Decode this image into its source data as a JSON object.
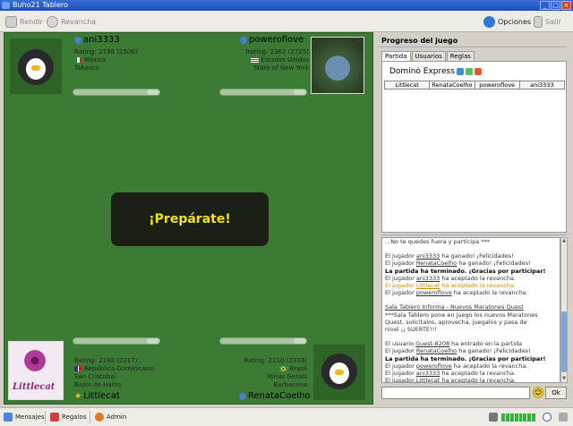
{
  "window": {
    "title": "Buho21 Tablero"
  },
  "toolbar": {
    "rendir": "Rendir",
    "revancha": "Revancha",
    "opciones": "Opciones",
    "salir": "Salir"
  },
  "players": {
    "top_left": {
      "name": "ani3333",
      "rating": "Rating: 2196 (2506)",
      "country": "México",
      "region": "Tabasco"
    },
    "top_right": {
      "name": "poweroflove",
      "rating": "Rating: 2362 (2725)",
      "country": "Estados Unidos",
      "region": "State of New York"
    },
    "bottom_left": {
      "name": "Littlecat",
      "rating": "Rating: 2193 (2217)",
      "country": "República Dominicana",
      "region": "San Cristobal",
      "city": "Bajos de Haina",
      "photo_text": "Littlecat"
    },
    "bottom_right": {
      "name": "RenataCoelho",
      "rating": "Rating: 2210 (2359)",
      "country": "Brasil",
      "region": "Minas Gerais",
      "city": "Barbacena"
    }
  },
  "board": {
    "message": "¡Prepárate!"
  },
  "side": {
    "title": "Progreso del juego",
    "tabs": [
      "Partida",
      "Usuarios",
      "Reglas"
    ],
    "game_name": "Dominó Express",
    "player_columns": [
      "Littlecat",
      "RenataCoelho",
      "poweroflove",
      "ani3333"
    ]
  },
  "chat": {
    "lines": [
      {
        "pre": "",
        "user": "",
        "post": "...No te quedes fuera y participa ***",
        "style": ""
      },
      {
        "pre": "",
        "user": "",
        "post": "",
        "style": "gap"
      },
      {
        "pre": "El jugador ",
        "user": "ani3333",
        "post": " ha ganado! ¡Felicidades!",
        "style": ""
      },
      {
        "pre": "El jugador ",
        "user": "RenataCoelho",
        "post": " ha ganado! ¡Felicidades!",
        "style": ""
      },
      {
        "pre": "",
        "user": "",
        "post": " La partida ha terminado.  ¡Gracias por participar!",
        "style": "bold"
      },
      {
        "pre": "El jugador ",
        "user": "ani3333",
        "post": " ha aceptado la revancha.",
        "style": ""
      },
      {
        "pre": "El jugador ",
        "user": "Littlecat",
        "post": " ha aceptado la revancha.",
        "style": "yellow"
      },
      {
        "pre": "El jugador ",
        "user": "poweroflove",
        "post": " ha aceptado la revancha.",
        "style": ""
      },
      {
        "pre": "",
        "user": "",
        "post": "",
        "style": "gap"
      },
      {
        "pre": "",
        "user": "",
        "post": " Sala Tablero Informa - Nuevos Maratones Quest",
        "style": "u"
      },
      {
        "pre": "",
        "user": "",
        "post": " ***Sala Tablero pone en juego los nuevos Maratones",
        "style": ""
      },
      {
        "pre": "",
        "user": "",
        "post": " Quest, solicítalos, aprovecha, juegalos y pasa de",
        "style": ""
      },
      {
        "pre": "",
        "user": "",
        "post": " nivel ¡¡ SUERTE!!!",
        "style": ""
      },
      {
        "pre": "",
        "user": "",
        "post": "",
        "style": "gap"
      },
      {
        "pre": "El usuario ",
        "user": "Guest-8208",
        "post": " ha entrado en la partida",
        "style": ""
      },
      {
        "pre": "El jugador ",
        "user": "RenataCoelho",
        "post": " ha ganado! ¡Felicidades!",
        "style": ""
      },
      {
        "pre": "",
        "user": "",
        "post": " La partida ha terminado.  ¡Gracias por participar!",
        "style": "bold"
      },
      {
        "pre": "El jugador ",
        "user": "poweroflove",
        "post": " ha aceptado la revancha.",
        "style": ""
      },
      {
        "pre": "El jugador ",
        "user": "ani3333",
        "post": " ha aceptado la revancha.",
        "style": ""
      },
      {
        "pre": "El jugador ",
        "user": "Littlecat",
        "post": " ha aceptado la revancha.",
        "style": ""
      }
    ],
    "ok_label": "Ok"
  },
  "statusbar": {
    "mensajes": "Mensajes",
    "regalos": "Regalos",
    "admin": "Admin"
  },
  "colors": {
    "board": "#3b7b34",
    "ready_text": "#f2e21c",
    "accent": "#1e4fb5"
  }
}
